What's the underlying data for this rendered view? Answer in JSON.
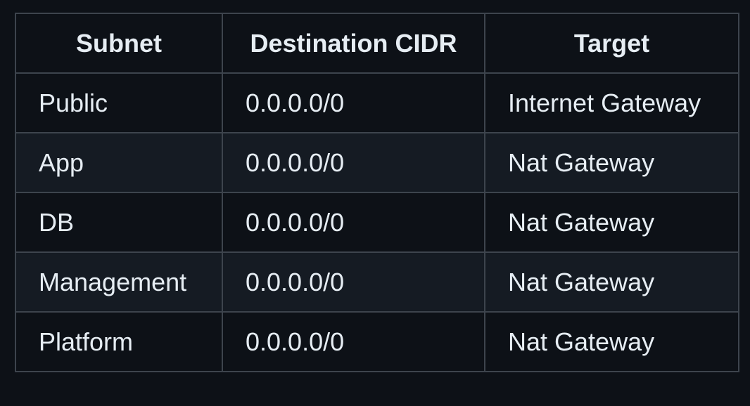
{
  "table": {
    "headers": [
      "Subnet",
      "Destination CIDR",
      "Target"
    ],
    "rows": [
      [
        "Public",
        "0.0.0.0/0",
        "Internet Gateway"
      ],
      [
        "App",
        "0.0.0.0/0",
        "Nat Gateway"
      ],
      [
        "DB",
        "0.0.0.0/0",
        "Nat Gateway"
      ],
      [
        "Management",
        "0.0.0.0/0",
        "Nat Gateway"
      ],
      [
        "Platform",
        "0.0.0.0/0",
        "Nat Gateway"
      ]
    ]
  },
  "colors": {
    "background": "#0d1117",
    "row_alt_background": "#151b23",
    "border": "#3d444d",
    "text": "#e6edf3"
  }
}
